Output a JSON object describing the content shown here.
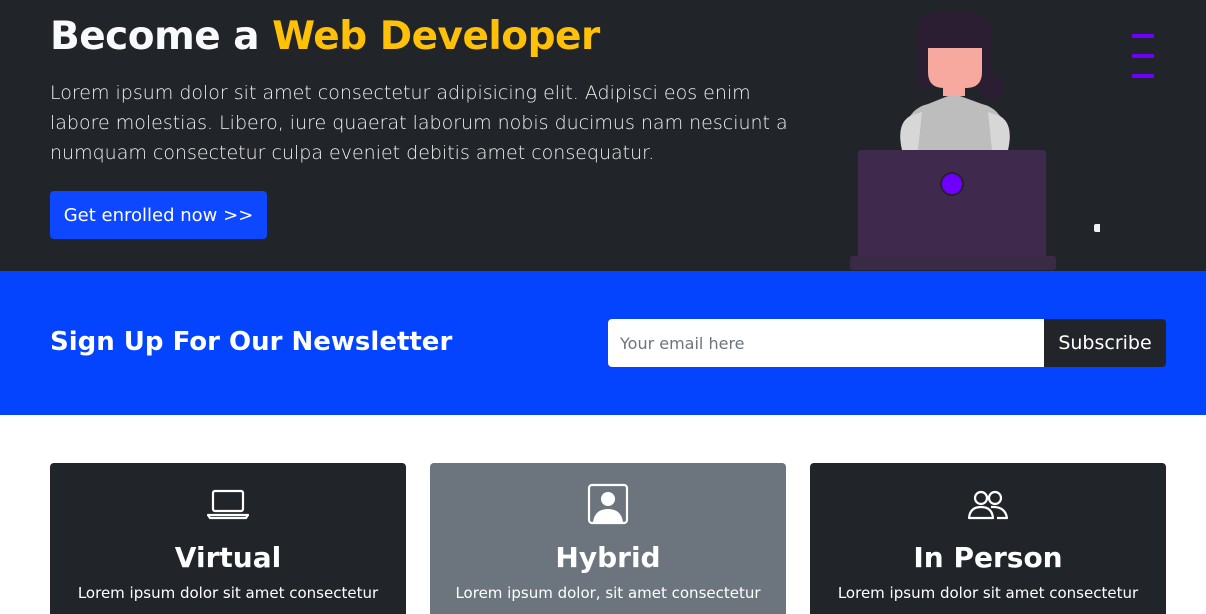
{
  "hero": {
    "title_prefix": "Become a ",
    "title_accent": "Web Developer",
    "text": "Lorem ipsum dolor sit amet consectetur adipisicing elit. Adipisci eos enim labore molestias. Libero, iure quaerat laborum nobis ducimus nam nesciunt a numquam consectetur culpa eveniet debitis amet consequatur.",
    "button_label": "Get enrolled now >>"
  },
  "newsletter": {
    "title": "Sign Up For Our Newsletter",
    "email_placeholder": "Your email here",
    "subscribe_label": "Subscribe"
  },
  "cards": [
    {
      "icon": "laptop-icon",
      "title": "Virtual",
      "text": "Lorem ipsum dolor sit amet consectetur"
    },
    {
      "icon": "person-badge-icon",
      "title": "Hybrid",
      "text": "Lorem ipsum dolor, sit amet consectetur"
    },
    {
      "icon": "people-icon",
      "title": "In Person",
      "text": "Lorem ipsum dolor sit amet consectetur"
    }
  ],
  "colors": {
    "dark": "#212529",
    "accent_yellow": "#ffc107",
    "primary_blue": "#0444ff",
    "gray_card": "#6c757d",
    "menu_purple": "#6f00ff"
  }
}
